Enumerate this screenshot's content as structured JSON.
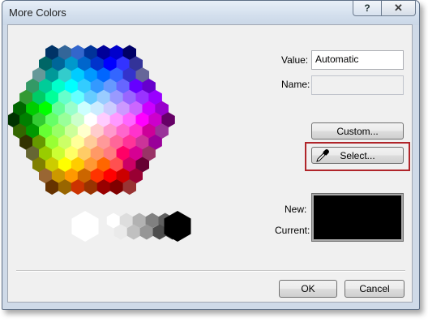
{
  "window": {
    "title": "More Colors",
    "help_label": "?",
    "close_label": "✕"
  },
  "fields": {
    "value_label": "Value:",
    "value": "Automatic",
    "name_label": "Name:",
    "name_value": ""
  },
  "buttons": {
    "custom_label": "Custom...",
    "select_label": "Select...",
    "ok_label": "OK",
    "cancel_label": "Cancel"
  },
  "preview": {
    "new_label": "New:",
    "current_label": "Current:",
    "new_color": "#000000",
    "current_color": "#000000"
  },
  "icons": {
    "eyedropper": "eyedropper-icon"
  },
  "palette": {
    "selected_color": "#003366",
    "rows": [
      [
        "#003366",
        "#336699",
        "#3366cc",
        "#003399",
        "#000099",
        "#0000cc",
        "#000066"
      ],
      [
        "#006666",
        "#006699",
        "#0099cc",
        "#0066cc",
        "#0033cc",
        "#0000ff",
        "#3333ff",
        "#333399"
      ],
      [
        "#669999",
        "#009999",
        "#33cccc",
        "#00ccff",
        "#0099ff",
        "#0066ff",
        "#3366ff",
        "#3333cc",
        "#666699"
      ],
      [
        "#339966",
        "#00cc99",
        "#00ffcc",
        "#00ffff",
        "#33ccff",
        "#3399ff",
        "#6699ff",
        "#6666ff",
        "#6600ff",
        "#6600cc"
      ],
      [
        "#339933",
        "#00cc66",
        "#00ff99",
        "#66ffcc",
        "#66ffff",
        "#66ccff",
        "#99ccff",
        "#9999ff",
        "#9966ff",
        "#9933ff",
        "#9900ff"
      ],
      [
        "#006600",
        "#00cc00",
        "#00ff00",
        "#66ff99",
        "#99ffcc",
        "#ccffff",
        "#ccecff",
        "#ccccff",
        "#cc99ff",
        "#cc66ff",
        "#cc00ff",
        "#9900cc"
      ],
      [
        "#003300",
        "#008000",
        "#33cc33",
        "#66ff66",
        "#99ff99",
        "#ccffcc",
        "#ffffff",
        "#ffccff",
        "#ff99ff",
        "#ff66ff",
        "#ff00ff",
        "#cc00cc",
        "#660066"
      ],
      [
        "#336600",
        "#009900",
        "#66ff33",
        "#99ff66",
        "#ccff99",
        "#ffffcc",
        "#ffcccc",
        "#ff99cc",
        "#ff66cc",
        "#ff33cc",
        "#cc0099",
        "#993399"
      ],
      [
        "#333300",
        "#669900",
        "#99ff33",
        "#ccff66",
        "#ffff99",
        "#ffcc99",
        "#ff9999",
        "#ff6699",
        "#ff3399",
        "#cc3399",
        "#990099"
      ],
      [
        "#666633",
        "#99cc00",
        "#ccff33",
        "#ffff66",
        "#ffcc66",
        "#ff9966",
        "#ff7c80",
        "#ff0066",
        "#d60093",
        "#993366"
      ],
      [
        "#808000",
        "#cccc00",
        "#ffff00",
        "#ffcc00",
        "#ff9933",
        "#ff6600",
        "#ff5050",
        "#cc0066",
        "#660033"
      ],
      [
        "#996633",
        "#cc9900",
        "#ff9900",
        "#cc6600",
        "#ff3300",
        "#ff0000",
        "#cc0000",
        "#990033"
      ],
      [
        "#663300",
        "#996600",
        "#cc3300",
        "#993300",
        "#990000",
        "#800000",
        "#993333"
      ]
    ],
    "grays_top": [
      "#ffffff",
      "#dddddd",
      "#b2b2b2",
      "#808080",
      "#5f5f5f"
    ],
    "grays_bottom": [
      "#eaeaea",
      "#c0c0c0",
      "#969696",
      "#4d4d4d",
      "#333333"
    ],
    "black": "#000000",
    "white": "#ffffff"
  }
}
